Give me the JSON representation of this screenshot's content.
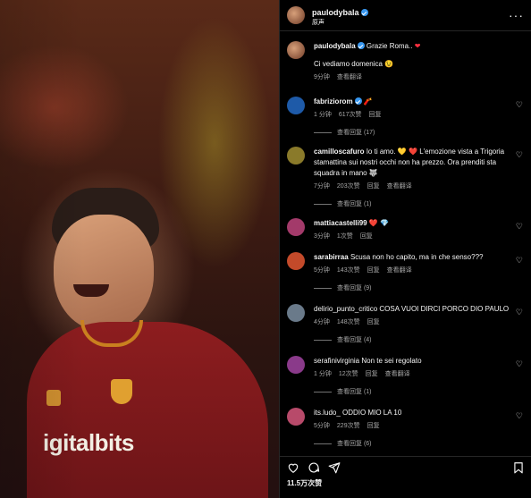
{
  "header": {
    "username": "paulodybala",
    "subtitle": "原声",
    "more": "···"
  },
  "media": {
    "sponsor_text": "igitalbits"
  },
  "caption": {
    "username": "paulodybala",
    "text": "Grazie Roma..",
    "line2": "Ci vediamo domenica 😉",
    "time": "9分钟",
    "translate": "查看翻译"
  },
  "comments": [
    {
      "username": "fabriziorom",
      "verified": true,
      "text": "🧨",
      "time": "1 分钟",
      "likes": "617次赞",
      "reply": "回复",
      "replies": "查看回复 (17)",
      "avatar": "#1e5aa8"
    },
    {
      "username": "camilloscafuro",
      "verified": false,
      "text": "Io ti amo. 💛 ❤️  L'emozione vista a Trigoria stamattina sui nostri occhi non ha prezzo. Ora prenditi sta squadra in mano 🐺",
      "time": "7分钟",
      "likes": "203次赞",
      "reply": "回复",
      "translate": "查看翻译",
      "replies": "查看回复 (1)",
      "avatar": "#8a7a2a"
    },
    {
      "username": "mattiacastelli99",
      "verified": false,
      "text": "❤️ 💎",
      "time": "3分钟",
      "likes": "1次赞",
      "reply": "回复",
      "avatar": "#a33a6a"
    },
    {
      "username": "sarabirraa",
      "verified": false,
      "text": "Scusa non ho capito, ma in che senso???",
      "time": "5分钟",
      "likes": "143次赞",
      "reply": "回复",
      "translate": "查看翻译",
      "replies": "查看回复 (9)",
      "avatar": "#c34a2a"
    },
    {
      "username": "delirio_punto_critico",
      "verified": false,
      "text": "COSA VUOI DIRCI PORCO DIO PAULO",
      "time": "4分钟",
      "likes": "148次赞",
      "reply": "回复",
      "replies": "查看回复 (4)",
      "avatar": "#6a7a8a"
    },
    {
      "username": "serafinivirginia",
      "verified": false,
      "text": "Non te sei regolato",
      "time": "1 分钟",
      "likes": "12次赞",
      "reply": "回复",
      "translate": "查看翻译",
      "replies": "查看回复 (1)",
      "avatar": "#8a3a8a"
    },
    {
      "username": "its.ludo_",
      "verified": false,
      "text": "ODDIO MIO LA 10",
      "time": "5分钟",
      "likes": "229次赞",
      "reply": "回复",
      "replies": "查看回复 (6)",
      "avatar": "#b84a6a"
    }
  ],
  "footer": {
    "likes": "11.5万次赞"
  },
  "colors": {
    "verified": "#3897f0",
    "heart": "#ff3040",
    "muted": "#a8a8a8"
  }
}
